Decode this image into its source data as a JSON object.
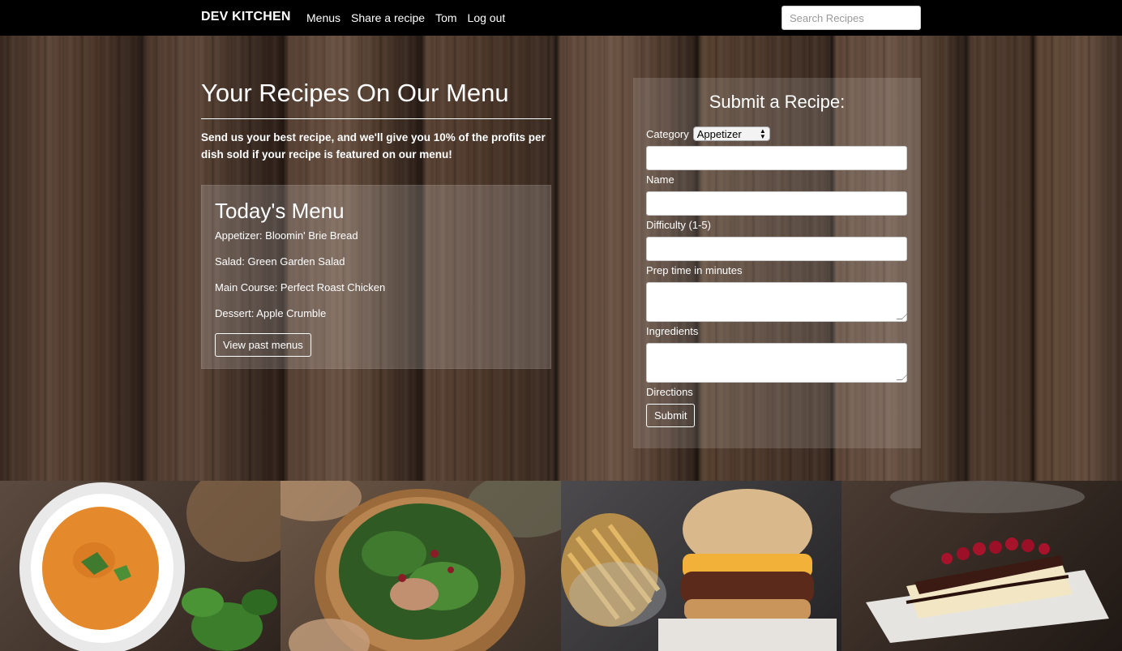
{
  "navbar": {
    "brand": "DEV KITCHEN",
    "links": [
      "Menus",
      "Share a recipe",
      "Tom",
      "Log out"
    ],
    "search_placeholder": "Search Recipes"
  },
  "hero": {
    "title": "Your Recipes On Our Menu",
    "description": "Send us your best recipe, and we'll give you 10% of the profits per dish sold if your recipe is featured on our menu!"
  },
  "todays_menu": {
    "title": "Today's Menu",
    "items": [
      "Appetizer: Bloomin' Brie Bread",
      "Salad: Green Garden Salad",
      "Main Course: Perfect Roast Chicken",
      "Dessert: Apple Crumble"
    ],
    "button_label": "View past menus"
  },
  "submit_form": {
    "title": "Submit a Recipe:",
    "category_label": "Category",
    "category_value": "Appetizer",
    "fields": [
      "Name",
      "Difficulty (1-5)",
      "Prep time in minutes",
      "Ingredients",
      "Directions"
    ],
    "submit_label": "Submit"
  },
  "food_images": [
    "soup",
    "salad",
    "burger",
    "cheesecake"
  ]
}
